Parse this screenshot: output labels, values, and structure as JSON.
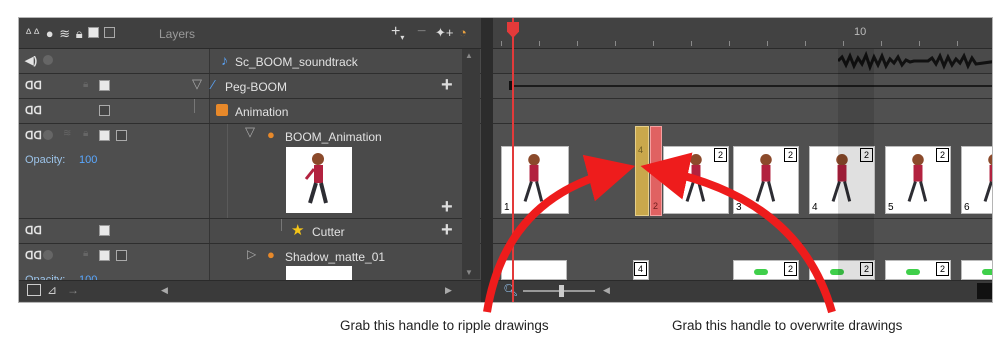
{
  "layers_panel": {
    "title": "Layers",
    "opacity_label": "Opacity:",
    "opacity_value": "100",
    "layers": [
      {
        "name": "Sc_BOOM_soundtrack"
      },
      {
        "name": "Peg-BOOM"
      },
      {
        "name": "Animation"
      },
      {
        "name": "BOOM_Animation"
      },
      {
        "name": "Cutter"
      },
      {
        "name": "Shadow_matte_01"
      }
    ]
  },
  "timeline": {
    "ruler_marker": "10",
    "frame_numbers": [
      "1",
      "2",
      "3",
      "4",
      "5",
      "6"
    ],
    "exposure_badges": [
      "4",
      "2",
      "2",
      "2",
      "2",
      "2"
    ],
    "lower_badges": [
      "4",
      "2",
      "2",
      "2",
      "2",
      "2"
    ]
  },
  "captions": {
    "left": "Grab this handle to ripple drawings",
    "right": "Grab this handle to overwrite drawings"
  },
  "colors": {
    "ripple_handle": "#c9a84c",
    "overwrite_handle": "#e06262",
    "arrow": "#ee1c1c",
    "playhead": "#e33a3a"
  }
}
